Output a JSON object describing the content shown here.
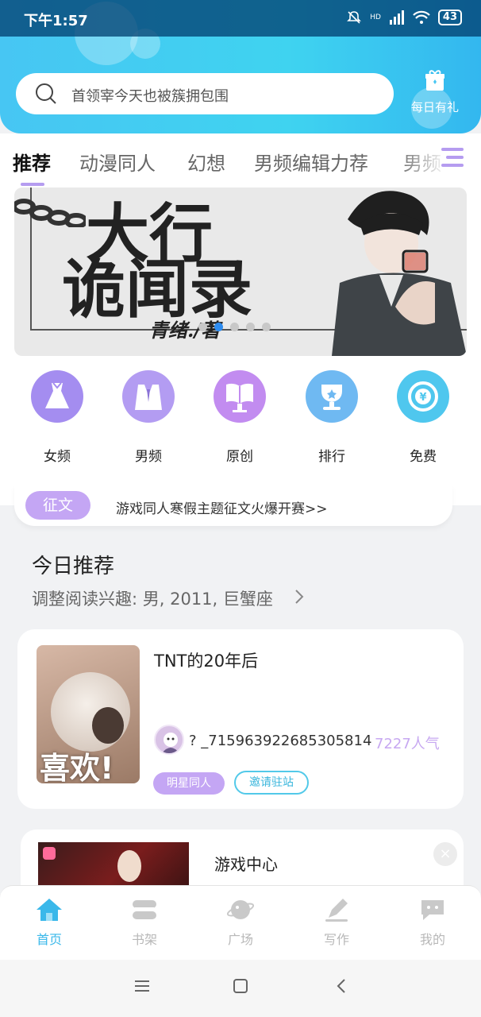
{
  "status": {
    "time": "下午1:57",
    "battery": "43",
    "network": "HD"
  },
  "search": {
    "placeholder": "首领宰今天也被簇拥包围"
  },
  "daily": {
    "label": "每日有礼"
  },
  "tabs": [
    {
      "label": "推荐",
      "active": true
    },
    {
      "label": "动漫同人"
    },
    {
      "label": "幻想"
    },
    {
      "label": "男频编辑力荐"
    },
    {
      "label": "男频"
    }
  ],
  "banner": {
    "title_line1": "大行",
    "title_line2": "诡闻录",
    "author": "青绪./著",
    "dots": 5,
    "active_dot": 1
  },
  "categories": [
    {
      "label": "女频",
      "icon": "dress-icon",
      "color": "#a48df0"
    },
    {
      "label": "男频",
      "icon": "shirt-icon",
      "color": "#b39cf2"
    },
    {
      "label": "原创",
      "icon": "book-icon",
      "color": "#c28cf0"
    },
    {
      "label": "排行",
      "icon": "trophy-icon",
      "color": "#6fb9f2"
    },
    {
      "label": "免费",
      "icon": "coin-icon",
      "color": "#4fc7ee"
    }
  ],
  "contest": {
    "tag": "征文",
    "text": "游戏同人寒假主题征文火爆开赛>>"
  },
  "today": {
    "title": "今日推荐",
    "subtitle": "调整阅读兴趣: 男, 2011, 巨蟹座"
  },
  "book": {
    "title": "TNT的20年后",
    "cover_text": "喜欢!",
    "author": "? _715963922685305814",
    "popularity": "7227人气",
    "tag1": "明星同人",
    "tag2": "邀请驻站"
  },
  "game": {
    "label": "游戏中心"
  },
  "nav": [
    {
      "label": "首页",
      "icon": "home-icon",
      "active": true
    },
    {
      "label": "书架",
      "icon": "bookshelf-icon"
    },
    {
      "label": "广场",
      "icon": "planet-icon"
    },
    {
      "label": "写作",
      "icon": "pen-icon"
    },
    {
      "label": "我的",
      "icon": "chat-bubble-icon"
    }
  ],
  "colors": {
    "accent": "#3ab8ea",
    "purple": "#c4a6f4",
    "dot_active": "#2d8cf0"
  }
}
